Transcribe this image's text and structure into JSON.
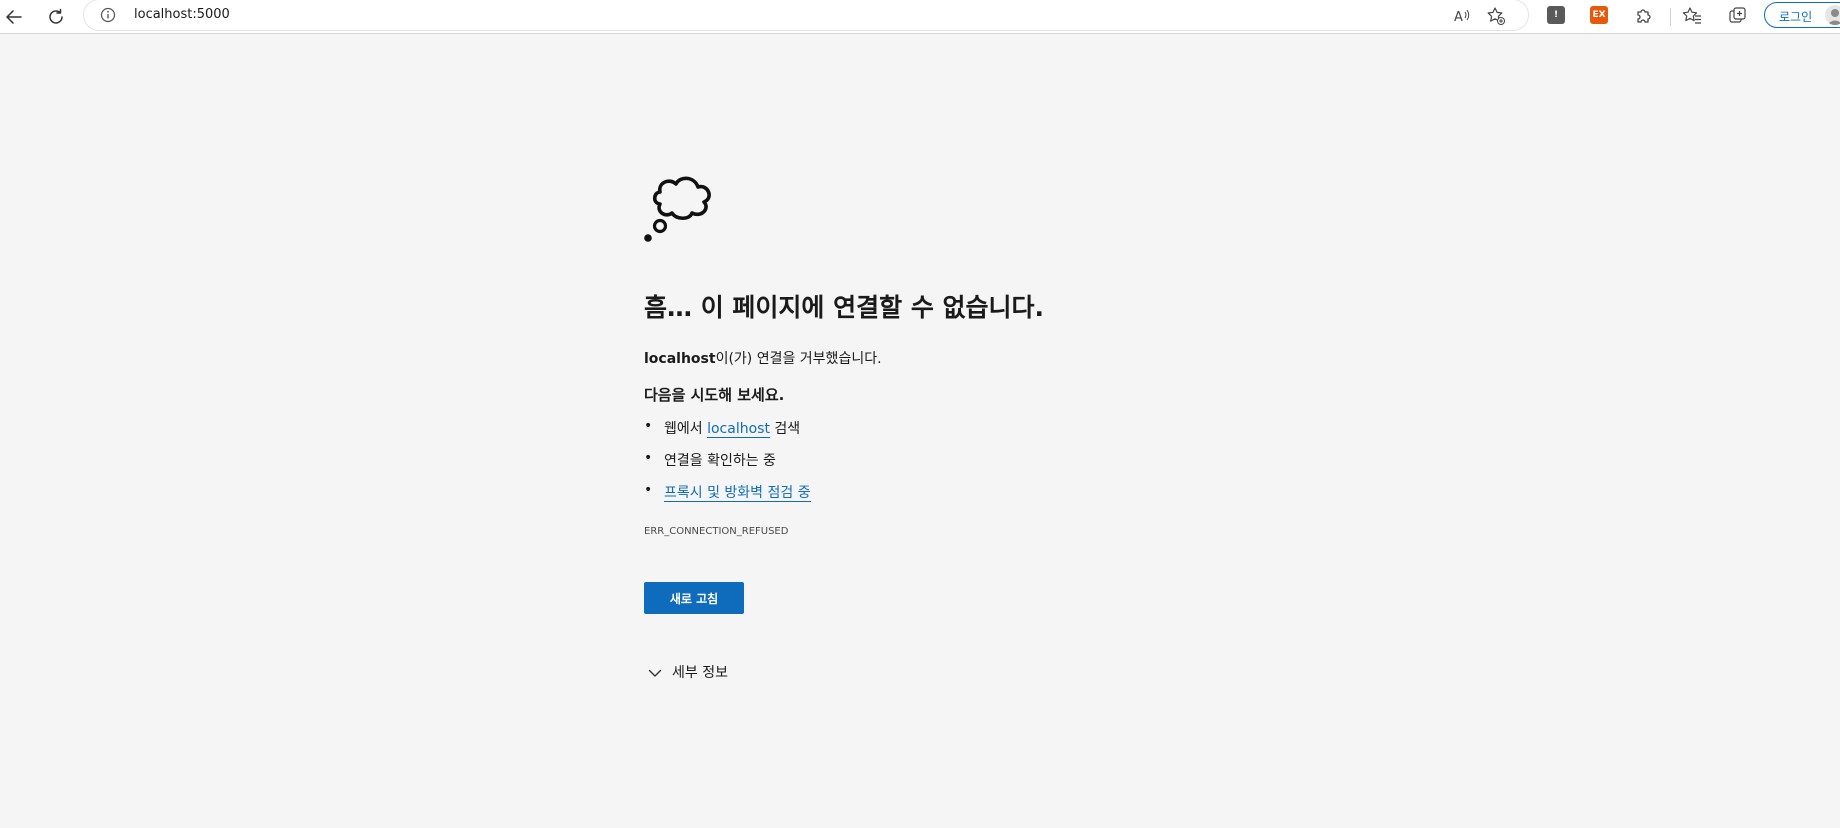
{
  "toolbar": {
    "address_url": "localhost:5000",
    "ext_exclaim_label": "!",
    "ext_ex_label": "EX",
    "login_label": "로그인"
  },
  "error_page": {
    "heading": "흠… 이 페이지에 연결할 수 없습니다.",
    "reason_host": "localhost",
    "reason_text": "이(가) 연결을 거부했습니다.",
    "try_title": "다음을 시도해 보세요.",
    "suggestions": [
      {
        "prefix": "웹에서 ",
        "link": "localhost",
        "suffix": " 검색"
      },
      {
        "text": "연결을 확인하는 중"
      },
      {
        "link": "프록시 및 방화벽 점검 중"
      }
    ],
    "bullet": "•",
    "error_code": "ERR_CONNECTION_REFUSED",
    "reload_label": "새로 고침",
    "details_label": "세부 정보"
  },
  "colors": {
    "accent": "#0f6cbd",
    "background": "#f5f5f5",
    "ext_ex": "#e8590c",
    "ext_exclaim": "#5a5a5a"
  },
  "icons": {
    "back": "back-arrow-icon",
    "refresh": "refresh-icon",
    "info": "info-icon",
    "read_aloud": "read-aloud-icon",
    "add_favorite": "add-favorite-icon",
    "extensions": "puzzle-icon",
    "favorites": "favorites-icon",
    "collections": "collections-icon",
    "error": "thought-cloud-icon",
    "details": "chevron-down-icon"
  }
}
